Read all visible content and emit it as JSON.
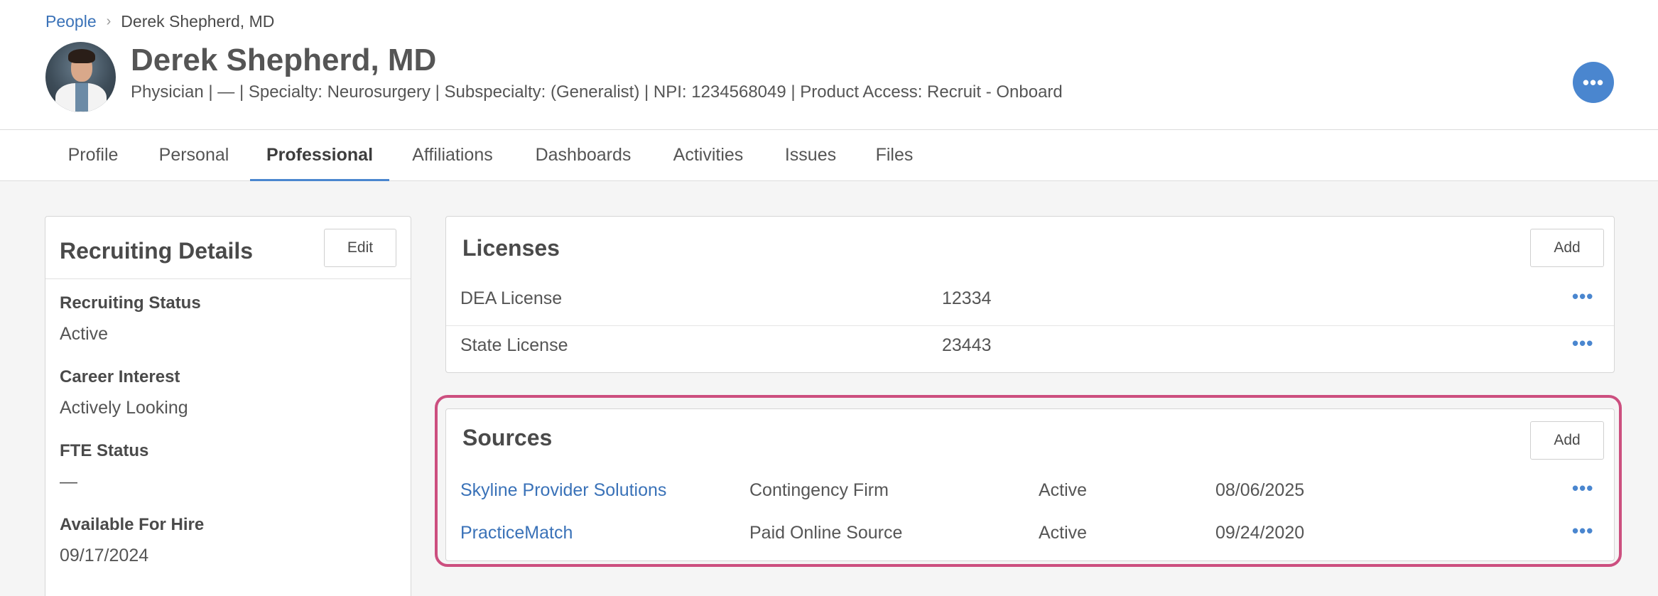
{
  "breadcrumb": {
    "parent": "People",
    "current": "Derek Shepherd, MD"
  },
  "profile": {
    "name": "Derek Shepherd, MD",
    "subtitle": "Physician | — | Specialty: Neurosurgery | Subspecialty: (Generalist) | NPI: 1234568049 | Product Access: Recruit - Onboard",
    "more_icon": "•••"
  },
  "tabs": [
    {
      "label": "Profile"
    },
    {
      "label": "Personal"
    },
    {
      "label": "Professional",
      "active": true
    },
    {
      "label": "Affiliations"
    },
    {
      "label": "Dashboards"
    },
    {
      "label": "Activities"
    },
    {
      "label": "Issues"
    },
    {
      "label": "Files"
    }
  ],
  "recruiting": {
    "title": "Recruiting Details",
    "edit_label": "Edit",
    "fields": [
      {
        "label": "Recruiting Status",
        "value": "Active"
      },
      {
        "label": "Career Interest",
        "value": "Actively Looking"
      },
      {
        "label": "FTE Status",
        "value": "—"
      },
      {
        "label": "Available For Hire",
        "value": "09/17/2024"
      }
    ]
  },
  "licenses": {
    "title": "Licenses",
    "add_label": "Add",
    "rows": [
      {
        "name": "DEA License",
        "number": "12334",
        "more": "•••"
      },
      {
        "name": "State License",
        "number": "23443",
        "more": "•••"
      }
    ]
  },
  "sources": {
    "title": "Sources",
    "add_label": "Add",
    "rows": [
      {
        "name": "Skyline Provider Solutions",
        "type": "Contingency Firm",
        "status": "Active",
        "date": "08/06/2025",
        "more": "•••"
      },
      {
        "name": "PracticeMatch",
        "type": "Paid Online Source",
        "status": "Active",
        "date": "09/24/2020",
        "more": "•••"
      }
    ]
  },
  "colors": {
    "accent": "#4a86cf",
    "link": "#3a72b8",
    "highlight": "#cc4f7f"
  }
}
